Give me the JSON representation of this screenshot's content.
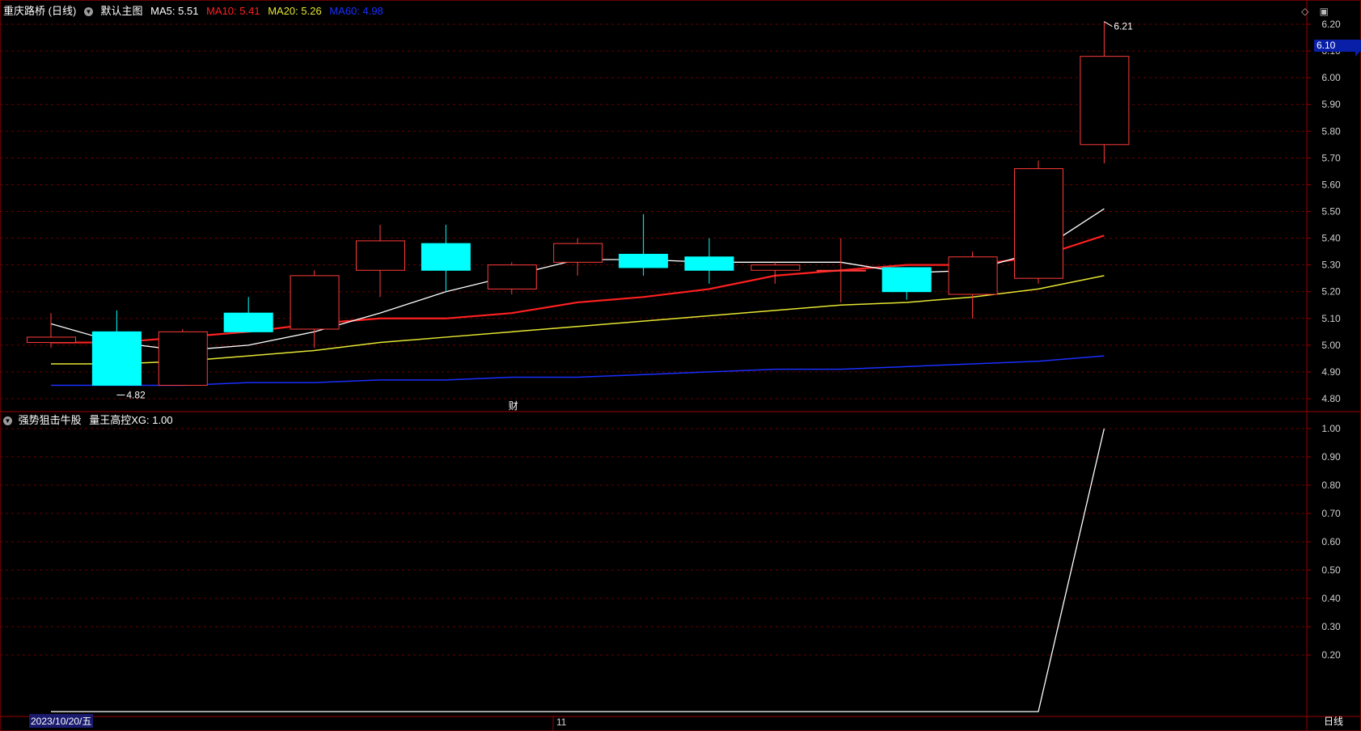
{
  "header": {
    "stock_title": "重庆路桥 (日线)",
    "main_chart_label": "默认主图",
    "ma5": "MA5: 5.51",
    "ma10": "MA10: 5.41",
    "ma20": "MA20: 5.26",
    "ma60": "MA60: 4.98"
  },
  "sub_header": {
    "indicator_name": "强势狙击牛股",
    "value_label": "量王高控XG: 1.00"
  },
  "top_icons": [
    "diamond-icon",
    "window-icon"
  ],
  "colors": {
    "up": "#ff3b3b",
    "down": "#00ffff",
    "ma5": "#ffffff",
    "ma10": "#ff2020",
    "ma20": "#e6e632",
    "ma60": "#1a2fff",
    "grid": "#6b0000",
    "indicator_line": "#ffffff",
    "badge": "#0a1fa8"
  },
  "chart_data": {
    "type": "candlestick",
    "price_axis": {
      "min": 4.8,
      "max": 6.2,
      "ticks": [
        "6.20",
        "6.10",
        "6.00",
        "5.90",
        "5.80",
        "5.70",
        "5.60",
        "5.50",
        "5.40",
        "5.30",
        "5.20",
        "5.10",
        "5.00",
        "4.90",
        "4.80"
      ]
    },
    "candles": [
      {
        "o": 5.01,
        "h": 5.12,
        "l": 4.99,
        "c": 5.03
      },
      {
        "o": 5.05,
        "h": 5.13,
        "l": 4.85,
        "c": 4.85
      },
      {
        "o": 4.85,
        "h": 5.06,
        "l": 4.85,
        "c": 5.05
      },
      {
        "o": 5.12,
        "h": 5.18,
        "l": 5.05,
        "c": 5.05
      },
      {
        "o": 5.06,
        "h": 5.28,
        "l": 4.99,
        "c": 5.26
      },
      {
        "o": 5.28,
        "h": 5.45,
        "l": 5.18,
        "c": 5.39
      },
      {
        "o": 5.38,
        "h": 5.45,
        "l": 5.2,
        "c": 5.28
      },
      {
        "o": 5.21,
        "h": 5.31,
        "l": 5.19,
        "c": 5.3
      },
      {
        "o": 5.31,
        "h": 5.4,
        "l": 5.26,
        "c": 5.38
      },
      {
        "o": 5.34,
        "h": 5.49,
        "l": 5.26,
        "c": 5.29
      },
      {
        "o": 5.33,
        "h": 5.4,
        "l": 5.23,
        "c": 5.28
      },
      {
        "o": 5.28,
        "h": 5.31,
        "l": 5.23,
        "c": 5.3
      },
      {
        "o": 5.28,
        "h": 5.4,
        "l": 5.16,
        "c": 5.28
      },
      {
        "o": 5.29,
        "h": 5.29,
        "l": 5.17,
        "c": 5.2
      },
      {
        "o": 5.19,
        "h": 5.35,
        "l": 5.1,
        "c": 5.33
      },
      {
        "o": 5.25,
        "h": 5.69,
        "l": 5.23,
        "c": 5.66
      },
      {
        "o": 5.75,
        "h": 6.21,
        "l": 5.68,
        "c": 6.08
      }
    ],
    "ma5": [
      5.08,
      5.01,
      4.98,
      5.0,
      5.05,
      5.12,
      5.2,
      5.26,
      5.32,
      5.32,
      5.31,
      5.31,
      5.31,
      5.27,
      5.28,
      5.35,
      5.51
    ],
    "ma10": [
      5.01,
      5.01,
      5.03,
      5.05,
      5.08,
      5.1,
      5.1,
      5.12,
      5.16,
      5.18,
      5.21,
      5.26,
      5.28,
      5.3,
      5.3,
      5.33,
      5.41
    ],
    "ma20": [
      4.93,
      4.93,
      4.94,
      4.96,
      4.98,
      5.01,
      5.03,
      5.05,
      5.07,
      5.09,
      5.11,
      5.13,
      5.15,
      5.16,
      5.18,
      5.21,
      5.26
    ],
    "ma60": [
      4.85,
      4.85,
      4.85,
      4.86,
      4.86,
      4.87,
      4.87,
      4.88,
      4.88,
      4.89,
      4.9,
      4.91,
      4.91,
      4.92,
      4.93,
      4.94,
      4.96
    ],
    "high_label": "6.21",
    "low_label": "4.82",
    "current_price_badge": "6.10",
    "marker_label": "财",
    "indicator": {
      "axis_ticks": [
        "1.00",
        "0.90",
        "0.80",
        "0.70",
        "0.60",
        "0.50",
        "0.40",
        "0.30",
        "0.20"
      ],
      "axis_min": 0,
      "axis_max": 1.0,
      "values": [
        0,
        0,
        0,
        0,
        0,
        0,
        0,
        0,
        0,
        0,
        0,
        0,
        0,
        0,
        0,
        0,
        1.0
      ]
    }
  },
  "footer": {
    "date_label": "2023/10/20/五",
    "month_tick": "11",
    "period_label": "日线"
  }
}
